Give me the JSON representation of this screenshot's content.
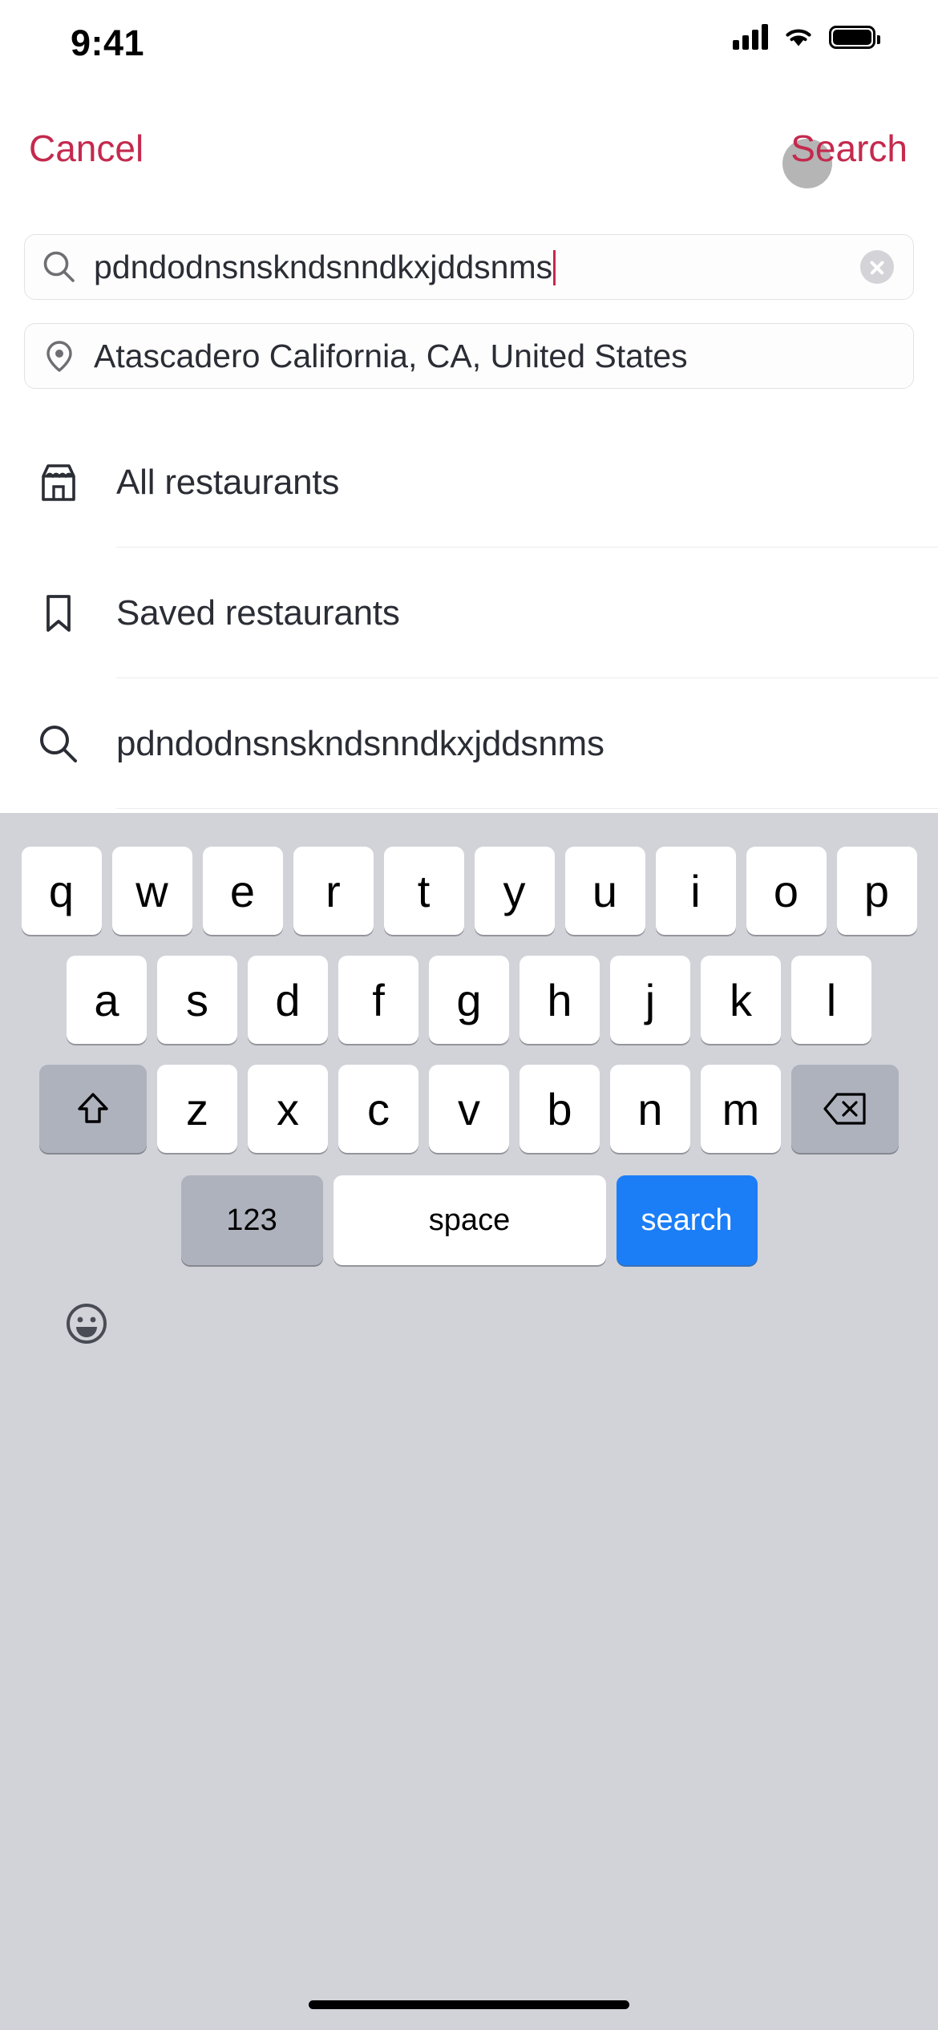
{
  "status_bar": {
    "time": "9:41",
    "signal_icon": "cellular-signal-icon",
    "wifi_icon": "wifi-icon",
    "battery_icon": "battery-full-icon"
  },
  "nav": {
    "cancel_label": "Cancel",
    "search_label": "Search",
    "accent_color": "#c42a4e",
    "touch_indicator": "touch-indicator-dot"
  },
  "search_field": {
    "icon": "search-icon",
    "value": "pdndodnsnskndsnndkxjddsnms",
    "placeholder": "Search",
    "clear_icon": "clear-circle-icon",
    "has_caret": true
  },
  "location_field": {
    "icon": "location-pin-icon",
    "value": "Atascadero California, CA, United States",
    "placeholder": "Location"
  },
  "suggestions": [
    {
      "icon": "storefront-icon",
      "label": "All restaurants"
    },
    {
      "icon": "bookmark-icon",
      "label": "Saved restaurants"
    },
    {
      "icon": "search-icon",
      "label": "pdndodnsnskndsnndkxjddsnms"
    }
  ],
  "keyboard": {
    "row1": [
      "q",
      "w",
      "e",
      "r",
      "t",
      "y",
      "u",
      "i",
      "o",
      "p"
    ],
    "row2": [
      "a",
      "s",
      "d",
      "f",
      "g",
      "h",
      "j",
      "k",
      "l"
    ],
    "row3": [
      "z",
      "x",
      "c",
      "v",
      "b",
      "n",
      "m"
    ],
    "shift_icon": "shift-arrow-icon",
    "backspace_icon": "backspace-delete-icon",
    "numbers_label": "123",
    "space_label": "space",
    "return_label": "search",
    "return_color": "#1b7ef7",
    "emoji_icon": "emoji-smiley-icon",
    "background_color": "#d1d3d9"
  },
  "home_indicator": "home-indicator-bar"
}
